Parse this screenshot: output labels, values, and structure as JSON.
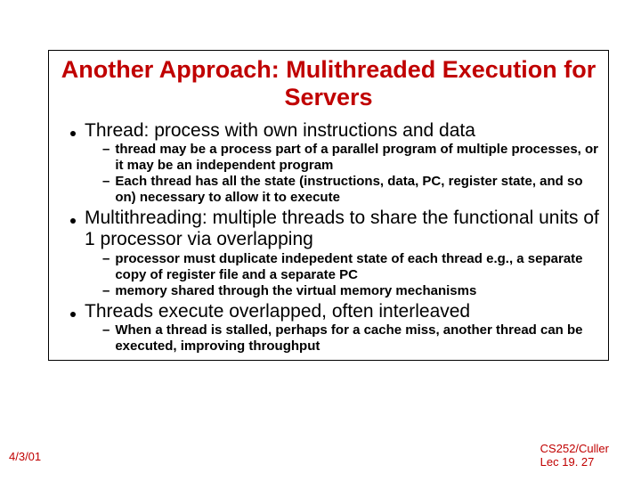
{
  "title": "Another Approach: Mulithreaded Execution for Servers",
  "bullets": [
    {
      "text": "Thread: process with own instructions and data",
      "subs": [
        "thread may be a process part of a parallel program of multiple processes, or it may be an independent program",
        "Each thread has all the state (instructions, data, PC, register state, and so on) necessary to allow it to execute"
      ]
    },
    {
      "text": "Multithreading: multiple threads to share the functional units of 1 processor via overlapping",
      "subs": [
        "processor must duplicate indepedent state of each thread e.g., a separate copy of register file and a separate PC",
        "memory shared through the virtual memory mechanisms"
      ]
    },
    {
      "text": "Threads execute overlapped, often interleaved",
      "subs": [
        "When a thread is stalled, perhaps for a cache miss, another thread can be executed, improving throughput"
      ]
    }
  ],
  "footer": {
    "date": "4/3/01",
    "course_line1": "CS252/Culler",
    "course_line2": "Lec 19. 27"
  }
}
